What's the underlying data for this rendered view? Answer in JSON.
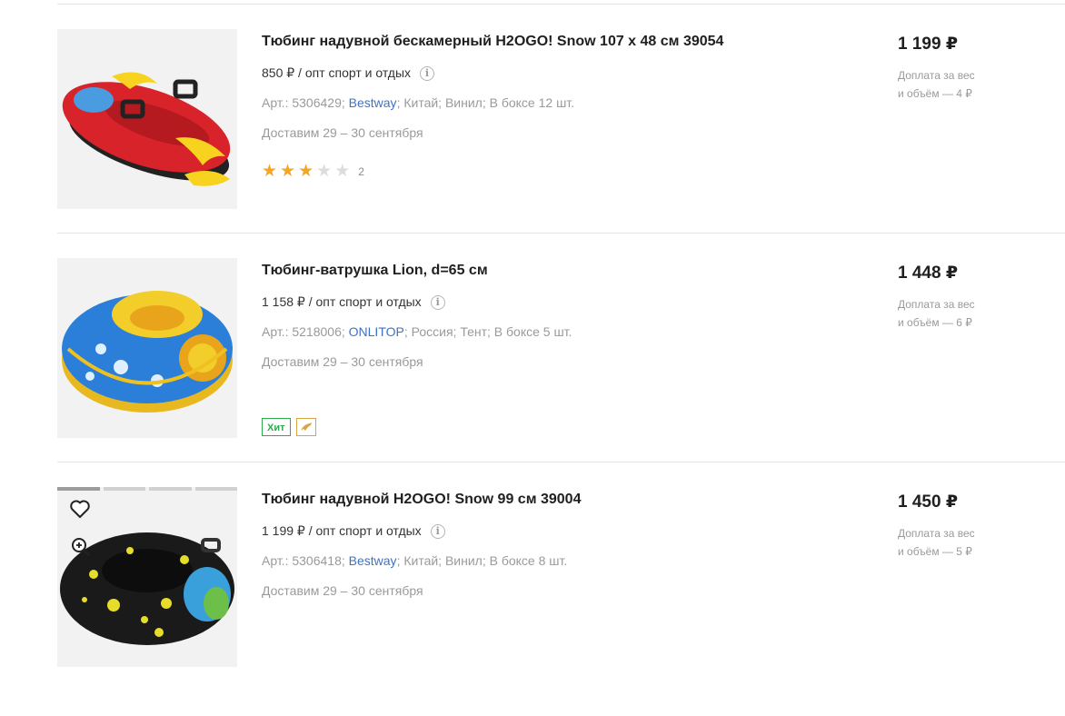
{
  "products": [
    {
      "title": "Тюбинг надувной бескамерный H2OGO! Snow 107 x 48 см 39054",
      "wholesale": "850 ₽ / опт спорт и отдых",
      "article": "Арт.: 5306429;",
      "brand": "Bestway",
      "details": "; Китай; Винил; В боксе 12 шт.",
      "delivery": "Доставим 29 – 30 сентября",
      "rating": {
        "stars": 3,
        "max": 5,
        "count": "2"
      },
      "price": "1 199 ₽",
      "surcharge_line1": "Доплата за вес",
      "surcharge_line2": "и объём — 4 ₽"
    },
    {
      "title": "Тюбинг-ватрушка Lion, d=65 см",
      "wholesale": "1 158 ₽ / опт спорт и отдых",
      "article": "Арт.: 5218006;",
      "brand": "ONLITOP",
      "details": "; Россия; Тент; В боксе 5 шт.",
      "delivery": "Доставим 29 – 30 сентября",
      "badge": "Хит",
      "price": "1 448 ₽",
      "surcharge_line1": "Доплата за вес",
      "surcharge_line2": "и объём — 6 ₽"
    },
    {
      "title": "Тюбинг надувной H2OGO! Snow 99 см 39004",
      "wholesale": "1 199 ₽ / опт спорт и отдых",
      "article": "Арт.: 5306418;",
      "brand": "Bestway",
      "details": "; Китай; Винил; В боксе 8 шт.",
      "delivery": "Доставим 29 – 30 сентября",
      "price": "1 450 ₽",
      "surcharge_line1": "Доплата за вес",
      "surcharge_line2": "и объём — 5 ₽"
    }
  ],
  "icons": {
    "info": "info-icon",
    "star": "star-icon",
    "heart": "heart-icon",
    "zoom": "zoom-in-icon",
    "dolphin": "dolphin-icon"
  },
  "colors": {
    "brand_link": "#3d72c8",
    "star_filled": "#f5a623",
    "badge_hit": "#2eaa4d"
  }
}
